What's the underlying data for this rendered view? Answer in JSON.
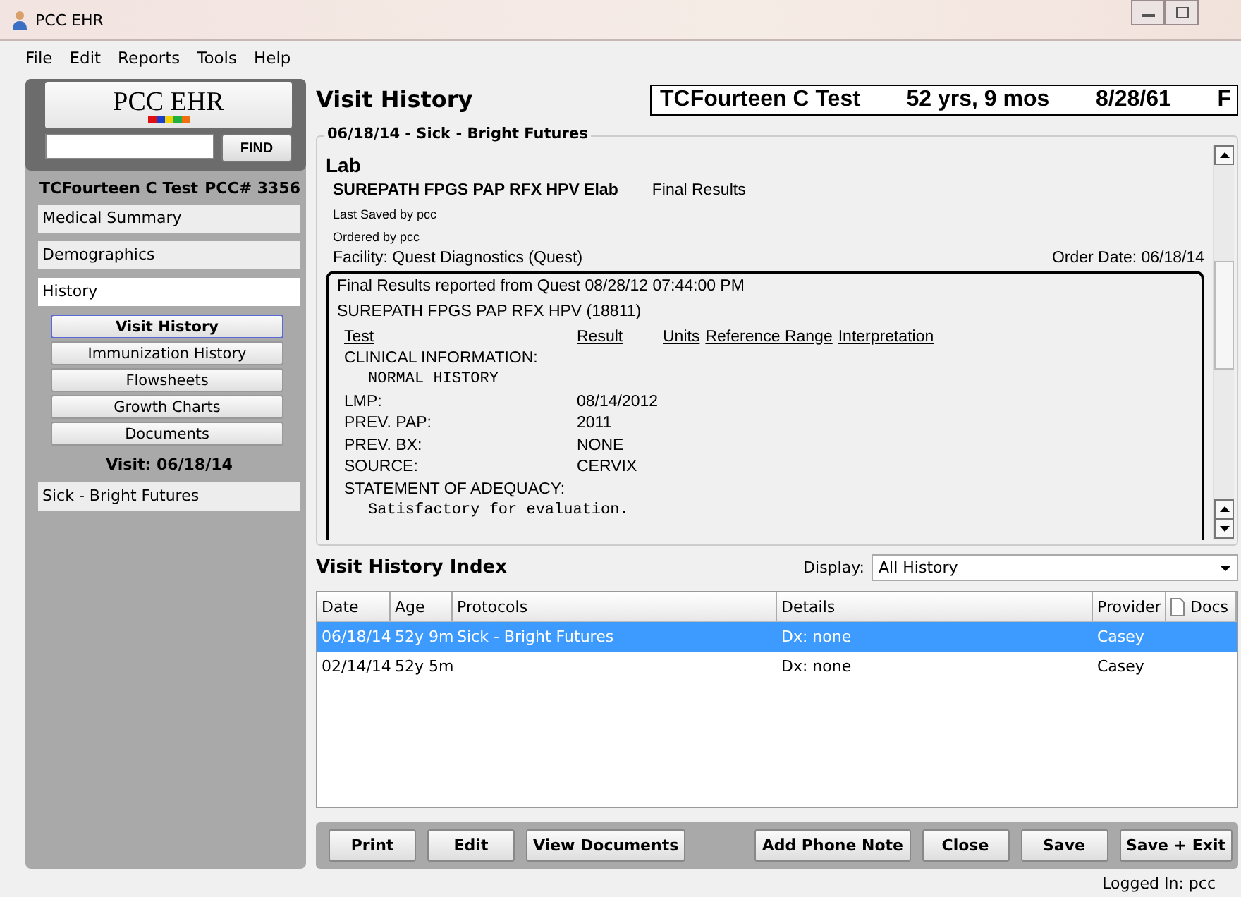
{
  "window": {
    "title": "PCC EHR"
  },
  "menu": [
    "File",
    "Edit",
    "Reports",
    "Tools",
    "Help"
  ],
  "sidebar": {
    "logo": "PCC EHR",
    "find_button": "FIND",
    "patient_name": "TCFourteen C Test",
    "patient_number": "PCC# 3356",
    "items": [
      {
        "label": "Medical Summary",
        "selected": false
      },
      {
        "label": "Demographics",
        "selected": false
      },
      {
        "label": "History",
        "selected": true
      }
    ],
    "sub_items": [
      {
        "label": "Visit History",
        "selected": true
      },
      {
        "label": "Immunization History",
        "selected": false
      },
      {
        "label": "Flowsheets",
        "selected": false
      },
      {
        "label": "Growth Charts",
        "selected": false
      },
      {
        "label": "Documents",
        "selected": false
      }
    ],
    "visit_label": "Visit: 06/18/14",
    "visits": [
      {
        "label": "Sick - Bright Futures",
        "selected": false
      }
    ]
  },
  "main": {
    "title": "Visit History",
    "banner": [
      "TCFourteen C Test",
      "52 yrs, 9 mos",
      "8/28/61",
      "F"
    ],
    "group_title": "06/18/14 - Sick - Bright Futures",
    "section": "Lab",
    "order_name": "SUREPATH FPGS PAP RFX HPV Elab",
    "order_status": "Final Results",
    "last_saved": "Last Saved by pcc",
    "ordered_by": "Ordered by pcc",
    "facility": "Facility: Quest Diagnostics (Quest)",
    "order_date": "Order Date: 06/18/14",
    "report": {
      "header": "Final Results reported from Quest 08/28/12 07:44:00 PM",
      "code": "SUREPATH FPGS PAP RFX HPV (18811)",
      "columns": [
        "Test",
        "Result",
        "Units",
        "Reference Range",
        "Interpretation"
      ],
      "rows": [
        {
          "kind": "label",
          "test": "CLINICAL INFORMATION:"
        },
        {
          "kind": "mono",
          "test": "NORMAL HISTORY"
        },
        {
          "kind": "label",
          "test": "LMP:",
          "result": "08/14/2012"
        },
        {
          "kind": "label",
          "test": "PREV. PAP:",
          "result": "2011"
        },
        {
          "kind": "label",
          "test": "PREV. BX:",
          "result": "NONE"
        },
        {
          "kind": "label",
          "test": "SOURCE:",
          "result": "CERVIX"
        },
        {
          "kind": "label",
          "test": "STATEMENT OF ADEQUACY:"
        },
        {
          "kind": "mono",
          "test": "Satisfactory for evaluation."
        }
      ]
    }
  },
  "index": {
    "title": "Visit History Index",
    "display_label": "Display:",
    "display_value": "All History",
    "columns": [
      "Date",
      "Age",
      "Protocols",
      "Details",
      "Provider",
      "Docs"
    ],
    "rows": [
      {
        "cells": [
          "06/18/14",
          "52y 9m",
          "Sick - Bright Futures",
          "Dx: none",
          "Casey",
          ""
        ],
        "selected": true
      },
      {
        "cells": [
          "02/14/14",
          "52y 5m",
          "",
          "Dx: none",
          "Casey",
          ""
        ],
        "selected": false
      }
    ]
  },
  "buttons_left": [
    "Print",
    "Edit",
    "View Documents"
  ],
  "buttons_right": [
    "Add Phone Note",
    "Close",
    "Save",
    "Save + Exit"
  ],
  "status_bar": "Logged In: pcc"
}
